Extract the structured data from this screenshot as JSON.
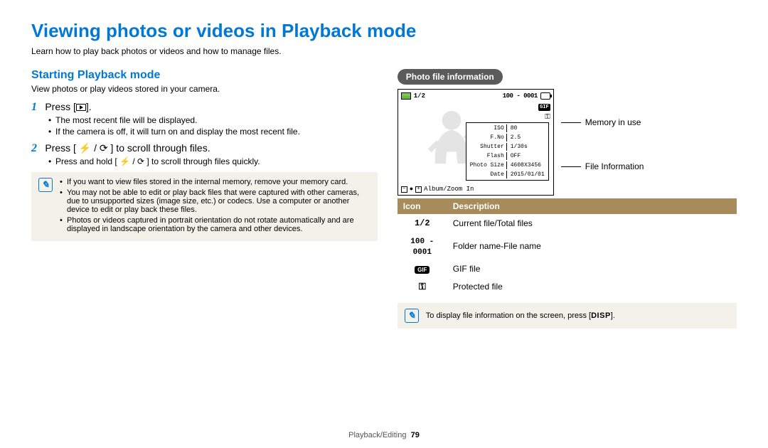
{
  "title": "Viewing photos or videos in Playback mode",
  "intro": "Learn how to play back photos or videos and how to manage files.",
  "left": {
    "heading": "Starting Playback mode",
    "desc": "View photos or play videos stored in your camera.",
    "step1_pre": "Press [",
    "step1_post": "].",
    "step1_bullets": [
      "The most recent file will be displayed.",
      "If the camera is off, it will turn on and display the most recent file."
    ],
    "step2": "Press [ ⚡ / ⟳ ] to scroll through files.",
    "step2_bullets": [
      "Press and hold [ ⚡ / ⟳ ] to scroll through files quickly."
    ],
    "tips": [
      "If you want to view files stored in the internal memory, remove your memory card.",
      "You may not be able to edit or play back files that were captured with other cameras, due to unsupported sizes (image size, etc.) or codecs. Use a computer or another device to edit or play back these files.",
      "Photos or videos captured in portrait orientation do not rotate automatically and are displayed in landscape orientation by the camera and other devices."
    ]
  },
  "right": {
    "pill": "Photo file information",
    "preview": {
      "count": "1/2",
      "folder": "100 - 0001",
      "info": {
        "iso_k": "ISO",
        "iso_v": "80",
        "fno_k": "F.No",
        "fno_v": "2.5",
        "shut_k": "Shutter",
        "shut_v": "1/30s",
        "flash_k": "Flash",
        "flash_v": "OFF",
        "size_k": "Photo Size",
        "size_v": "4608X3456",
        "date_k": "Date",
        "date_v": "2015/01/01"
      },
      "bottom": "Album/Zoom In"
    },
    "labels": {
      "mem": "Memory in use",
      "info": "File Information"
    },
    "table": {
      "h1": "Icon",
      "h2": "Description",
      "rows": [
        {
          "icon": "1/2",
          "cls": "mono",
          "desc": "Current file/Total files"
        },
        {
          "icon": "100 - 0001",
          "cls": "mono",
          "desc": "Folder name-File name"
        },
        {
          "icon": "GIF",
          "cls": "gif",
          "desc": "GIF file"
        },
        {
          "icon": "⚿",
          "cls": "key",
          "desc": "Protected file"
        }
      ]
    },
    "tip_pre": "To display file information on the screen, press [",
    "tip_disp": "DISP",
    "tip_post": "]."
  },
  "footer": {
    "section": "Playback/Editing",
    "page": "79"
  }
}
